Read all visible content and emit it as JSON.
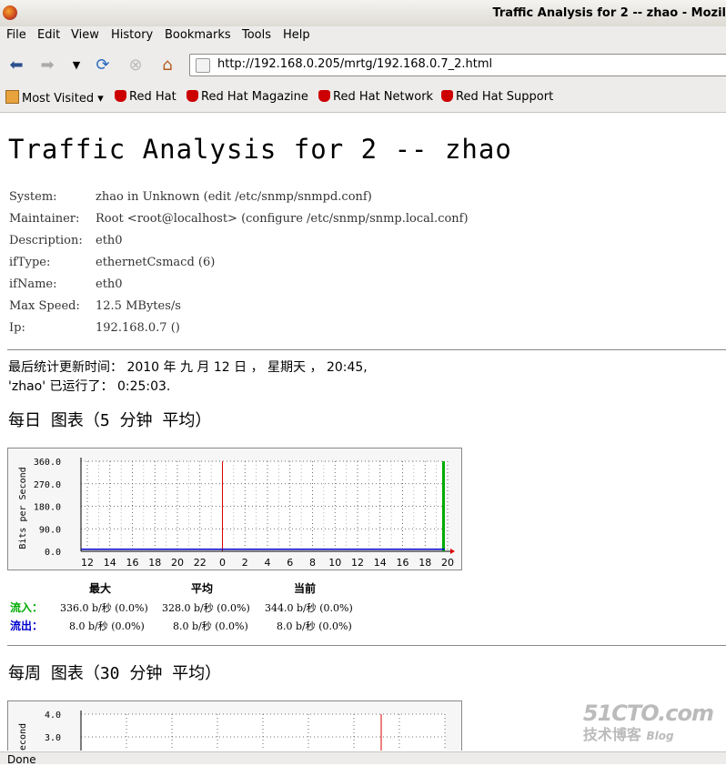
{
  "window": {
    "title": "Traffic Analysis for 2 -- zhao - Mozil"
  },
  "menu": [
    "File",
    "Edit",
    "View",
    "History",
    "Bookmarks",
    "Tools",
    "Help"
  ],
  "url": "http://192.168.0.205/mrtg/192.168.0.7_2.html",
  "bookmarks": [
    "Most Visited",
    "Red Hat",
    "Red Hat Magazine",
    "Red Hat Network",
    "Red Hat Support"
  ],
  "page": {
    "title": "Traffic Analysis for 2 -- zhao",
    "info": [
      {
        "k": "System:",
        "v": "zhao in Unknown (edit /etc/snmp/snmpd.conf)"
      },
      {
        "k": "Maintainer:",
        "v": "Root <root@localhost> (configure /etc/snmp/snmp.local.conf)"
      },
      {
        "k": "Description:",
        "v": "eth0"
      },
      {
        "k": "ifType:",
        "v": "ethernetCsmacd (6)"
      },
      {
        "k": "ifName:",
        "v": "eth0"
      },
      {
        "k": "Max Speed:",
        "v": "12.5 MBytes/s"
      },
      {
        "k": "Ip:",
        "v": "192.168.0.7 ()"
      }
    ],
    "updated": "最后统计更新时间：  2010 年 九 月 12 日 ， 星期天 ，  20:45,",
    "uptime": "'zhao' 已运行了：  0:25:03.",
    "daily_heading": "每日 图表（5 分钟 平均）",
    "weekly_heading": "每周 图表（30 分钟 平均）",
    "stats": {
      "headers": [
        "最大",
        "平均",
        "当前"
      ],
      "in_label": "流入：",
      "out_label": "流出：",
      "in": [
        "336.0 b/秒 (0.0%)",
        "328.0 b/秒 (0.0%)",
        "344.0 b/秒 (0.0%)"
      ],
      "out": [
        "8.0 b/秒 (0.0%)",
        "8.0 b/秒 (0.0%)",
        "8.0 b/秒 (0.0%)"
      ],
      "in_color": "#00aa00",
      "out_color": "#0000cc"
    }
  },
  "chart_data": [
    {
      "type": "area",
      "ylabel": "Bits per Second",
      "ylim": [
        0,
        360
      ],
      "yticks": [
        "360.0",
        "270.0",
        "180.0",
        "90.0",
        "0.0"
      ],
      "x": [
        "12",
        "14",
        "16",
        "18",
        "20",
        "22",
        "0",
        "2",
        "4",
        "6",
        "8",
        "10",
        "12",
        "14",
        "16",
        "18",
        "20"
      ],
      "series": [
        {
          "name": "流入：",
          "values": [
            360
          ],
          "color": "#00aa00"
        },
        {
          "name": "流出：",
          "values": [
            8
          ],
          "color": "#0000cc"
        }
      ]
    },
    {
      "type": "area",
      "ylabel": "Second",
      "yticks": [
        "4.0",
        "3.0"
      ]
    }
  ],
  "status": "Done",
  "watermark": [
    "51CTO.com",
    "技术博客",
    "Blog"
  ]
}
